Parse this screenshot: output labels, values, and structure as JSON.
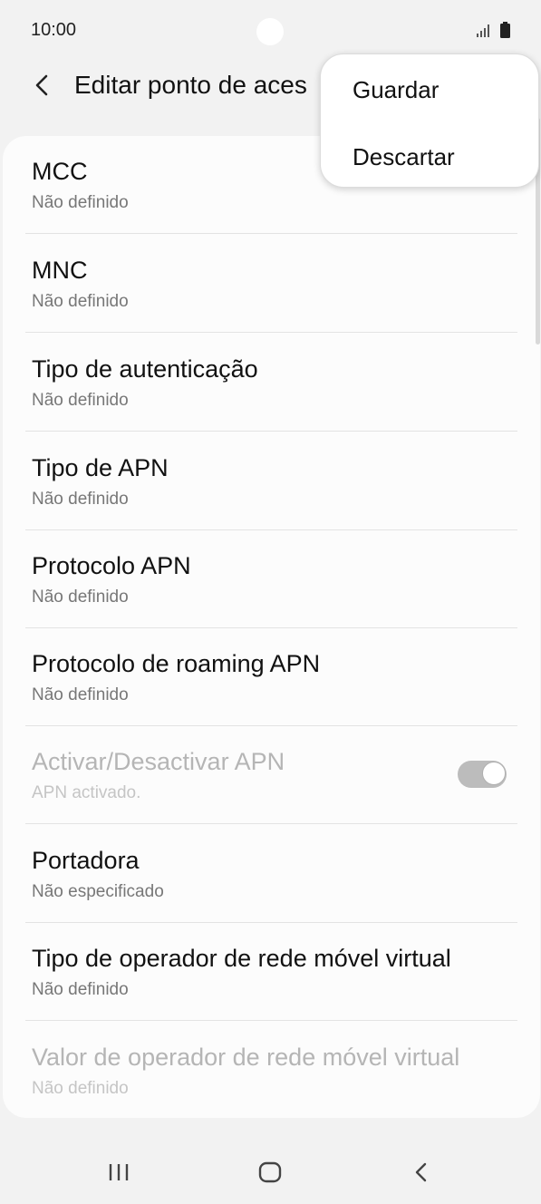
{
  "status_bar": {
    "time": "10:00"
  },
  "app_bar": {
    "title": "Editar ponto de aces"
  },
  "menu": {
    "items": [
      {
        "label": "Guardar"
      },
      {
        "label": "Descartar"
      }
    ]
  },
  "settings": [
    {
      "title": "MCC",
      "subtitle": "Não definido"
    },
    {
      "title": "MNC",
      "subtitle": "Não definido"
    },
    {
      "title": "Tipo de autenticação",
      "subtitle": "Não definido"
    },
    {
      "title": "Tipo de APN",
      "subtitle": "Não definido"
    },
    {
      "title": "Protocolo APN",
      "subtitle": "Não definido"
    },
    {
      "title": "Protocolo de roaming APN",
      "subtitle": "Não definido"
    },
    {
      "title": "Activar/Desactivar APN",
      "subtitle": "APN activado.",
      "toggle_on": true,
      "disabled": true
    },
    {
      "title": "Portadora",
      "subtitle": "Não especificado"
    },
    {
      "title": "Tipo de operador de rede móvel virtual",
      "subtitle": "Não definido"
    },
    {
      "title": "Valor de operador de rede móvel virtual",
      "subtitle": "Não definido",
      "disabled": true
    }
  ],
  "colors": {
    "background": "#f2f2f2",
    "card": "#fcfcfc",
    "toggle_track": "#bcbcbc"
  },
  "icons": [
    "back-arrow-icon",
    "signal-icon",
    "battery-icon",
    "recent-apps-icon",
    "home-icon",
    "nav-back-icon"
  ]
}
